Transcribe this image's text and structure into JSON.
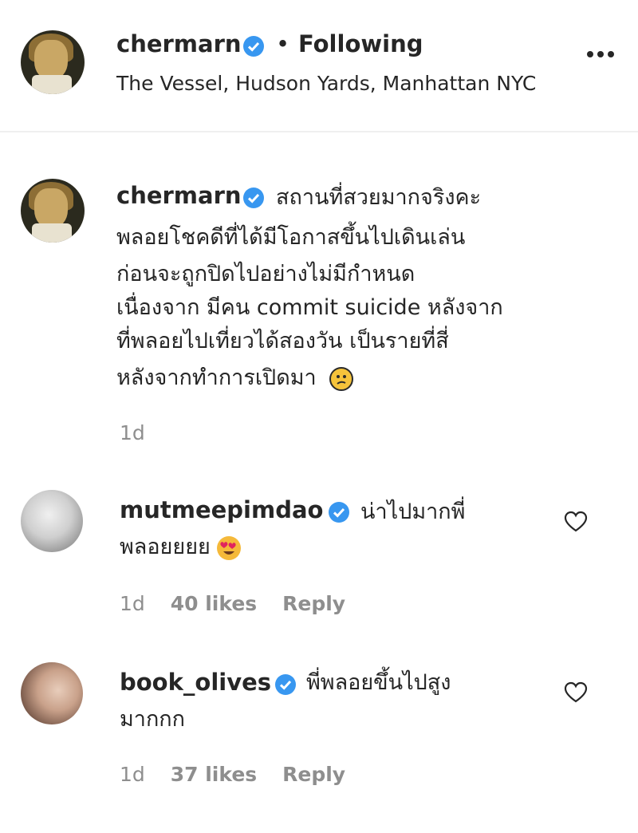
{
  "header": {
    "username": "chermarn",
    "separator": "•",
    "follow_status": "Following",
    "location": "The Vessel, Hudson Yards, Manhattan NYC"
  },
  "caption": {
    "username": "chermarn",
    "lines": [
      "สถานที่สวยมากจริงคะ",
      "พลอยโชคดีที่ได้มีโอกาสขึ้นไปเดินเล่น",
      "ก่อนจะถูกปิดไปอย่างไม่มีกำหนด",
      "เนื่องจาก มีคน commit suicide หลังจาก",
      "ที่พลอยไปเที่ยวได้สองวัน เป็นรายที่สี่",
      "หลังจากทำการเปิดมา"
    ],
    "emoji": "confused-face-emoji",
    "age": "1d"
  },
  "comments": [
    {
      "username": "mutmeepimdao",
      "lines": [
        "น่าไปมากพี่",
        "พลอยยยย"
      ],
      "emoji": "heart-eyes-emoji",
      "age": "1d",
      "likes": "40 likes",
      "reply": "Reply"
    },
    {
      "username": "book_olives",
      "lines": [
        "พี่พลอยขึ้นไปสูง",
        "มากกก"
      ],
      "age": "1d",
      "likes": "37 likes",
      "reply": "Reply"
    }
  ],
  "colors": {
    "verified": "#3897f0",
    "text": "#262626",
    "meta": "#8e8e8e"
  }
}
